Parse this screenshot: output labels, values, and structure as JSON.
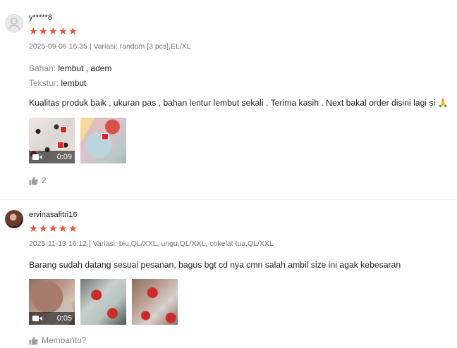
{
  "reviews": [
    {
      "username": "y*****8",
      "rating": 5,
      "date": "2025-09-06 16:35",
      "variation": "Variasi: random [3 pcs],EL/XL",
      "attributes": [
        {
          "label": "Bahan:",
          "value": "lembut , adem"
        },
        {
          "label": "Tekstur:",
          "value": "lembut"
        }
      ],
      "text": "Kualitas produk baik , ukuran pas , bahan lentur lembut sekali . Terima kasih . Next bakal order disini lagi si",
      "media": [
        {
          "type": "video",
          "duration": "0:09"
        },
        {
          "type": "image"
        }
      ],
      "likes": "2"
    },
    {
      "username": "ervinasafitri16",
      "rating": 5,
      "date": "2025-11-13 16:12",
      "variation": "Variasi: biu,QL/XXL, ungu,QL/XXL, cokelat tua,QL/XXL",
      "text": "Barang sudah datang sesuai pesanan, bagus bgt cd nya cmn salah ambil size ini agak kebesaran",
      "media": [
        {
          "type": "video",
          "duration": "0:05"
        },
        {
          "type": "image"
        },
        {
          "type": "image"
        }
      ],
      "likes": "Membantu?"
    }
  ],
  "separator": "|",
  "colors": {
    "star": "#ee4d2d",
    "muted": "#757575"
  }
}
